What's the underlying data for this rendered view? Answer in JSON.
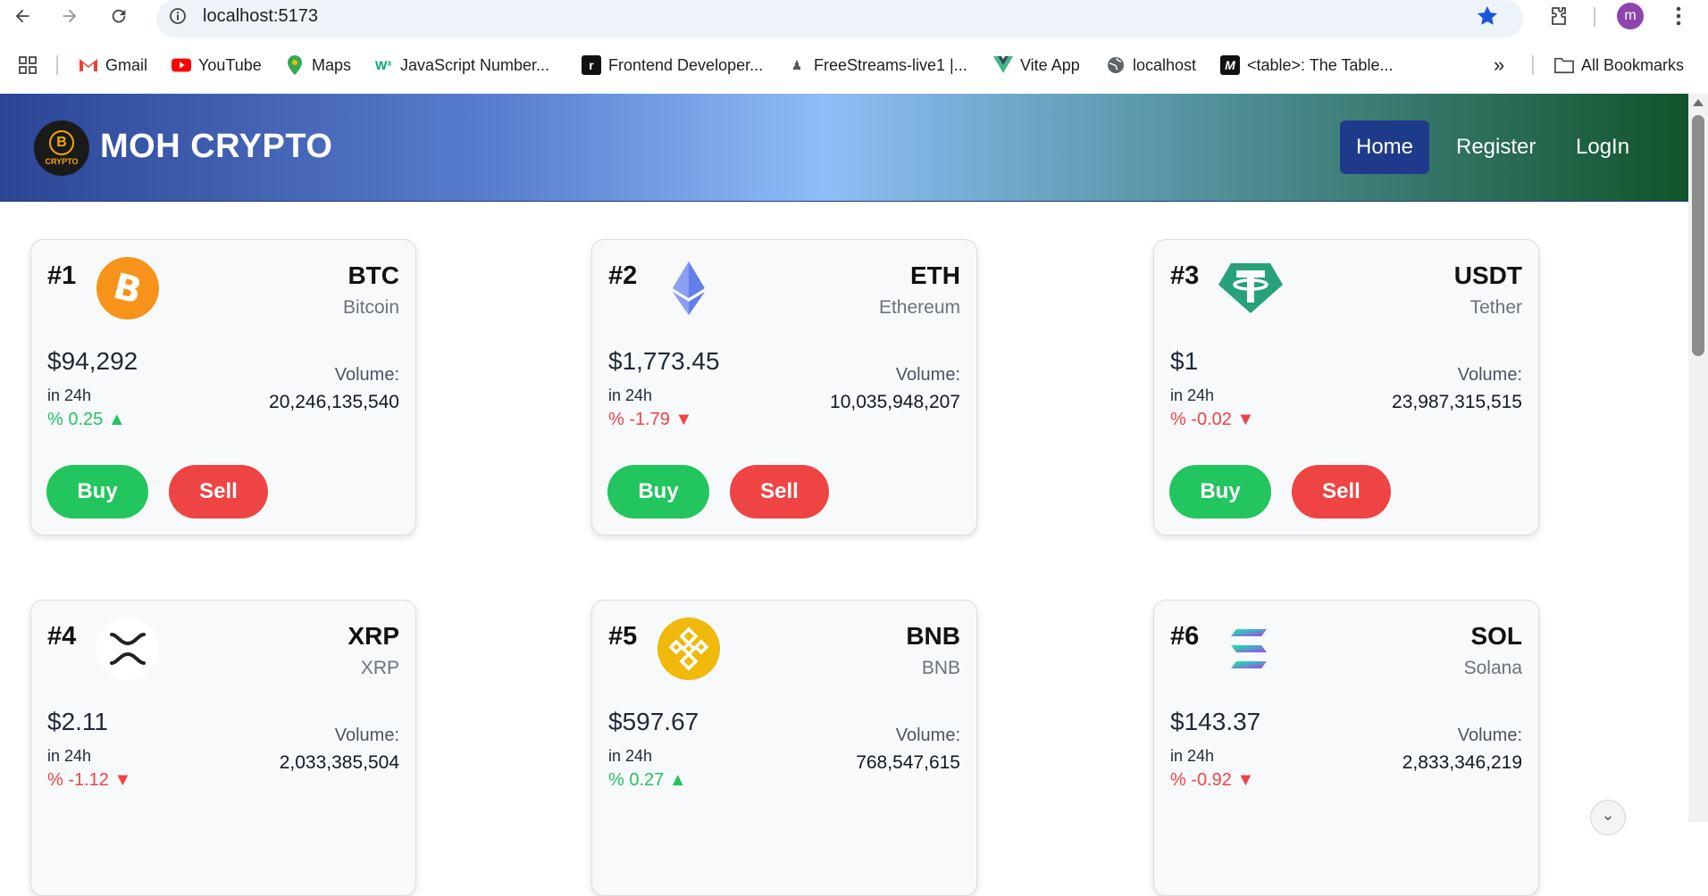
{
  "browser": {
    "url": "localhost:5173",
    "profile_initial": "m",
    "bookmarks": [
      {
        "label": "Gmail",
        "icon": "gmail-icon"
      },
      {
        "label": "YouTube",
        "icon": "youtube-icon"
      },
      {
        "label": "Maps",
        "icon": "maps-icon"
      },
      {
        "label": "JavaScript Number...",
        "icon": "w3schools-icon"
      },
      {
        "label": "Frontend Developer...",
        "icon": "frontend-icon"
      },
      {
        "label": "FreeStreams-live1 |...",
        "icon": "stream-icon"
      },
      {
        "label": "Vite App",
        "icon": "vue-icon"
      },
      {
        "label": "localhost",
        "icon": "globe-icon"
      },
      {
        "label": "<table>: The Table...",
        "icon": "mdn-icon"
      }
    ],
    "all_bookmarks": "All Bookmarks",
    "overflow": "»"
  },
  "header": {
    "logo_text": "CRYPTO",
    "logo_glyph": "B",
    "brand": "MOH CRYPTO",
    "nav": {
      "home": "Home",
      "register": "Register",
      "login": "LogIn"
    }
  },
  "labels": {
    "in24h": "in 24h",
    "volume": "Volume:",
    "buy": "Buy",
    "sell": "Sell"
  },
  "coins": [
    {
      "rank": "#1",
      "symbol": "BTC",
      "name": "Bitcoin",
      "price": "$94,292",
      "change": "% 0.25 ▲",
      "direction": "up",
      "volume": "20,246,135,540",
      "icon": "bitcoin-icon",
      "color": "#f7931a"
    },
    {
      "rank": "#2",
      "symbol": "ETH",
      "name": "Ethereum",
      "price": "$1,773.45",
      "change": "% -1.79 ▼",
      "direction": "down",
      "volume": "10,035,948,207",
      "icon": "ethereum-icon",
      "color": "#627eea"
    },
    {
      "rank": "#3",
      "symbol": "USDT",
      "name": "Tether",
      "price": "$1",
      "change": "% -0.02 ▼",
      "direction": "down",
      "volume": "23,987,315,515",
      "icon": "tether-icon",
      "color": "#26a17b"
    },
    {
      "rank": "#4",
      "symbol": "XRP",
      "name": "XRP",
      "price": "$2.11",
      "change": "% -1.12 ▼",
      "direction": "down",
      "volume": "2,033,385,504",
      "icon": "xrp-icon",
      "color": "#ffffff"
    },
    {
      "rank": "#5",
      "symbol": "BNB",
      "name": "BNB",
      "price": "$597.67",
      "change": "% 0.27 ▲",
      "direction": "up",
      "volume": "768,547,615",
      "icon": "bnb-icon",
      "color": "#f0b90b"
    },
    {
      "rank": "#6",
      "symbol": "SOL",
      "name": "Solana",
      "price": "$143.37",
      "change": "% -0.92 ▼",
      "direction": "down",
      "volume": "2,833,346,219",
      "icon": "solana-icon",
      "color": "#9945ff"
    }
  ],
  "colors": {
    "up": "#22c55e",
    "down": "#ef4444",
    "nav_active": "#1e3a8a"
  }
}
